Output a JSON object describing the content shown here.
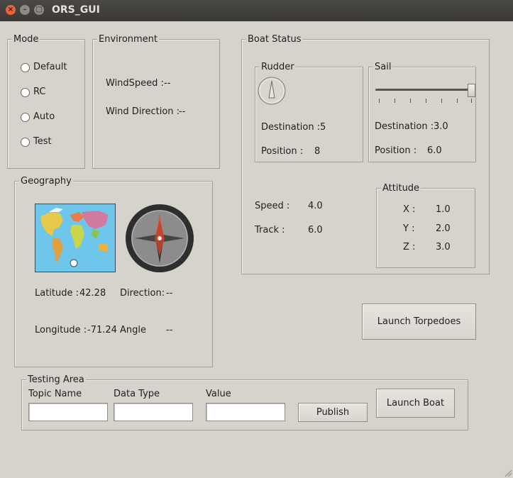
{
  "window": {
    "title": "ORS_GUI"
  },
  "mode": {
    "title": "Mode",
    "options": [
      "Default",
      "RC",
      "Auto",
      "Test"
    ]
  },
  "environment": {
    "title": "Environment",
    "wind_speed_label": "WindSpeed :",
    "wind_speed_value": "--",
    "wind_direction_label": "Wind Direction :",
    "wind_direction_value": "--"
  },
  "geography": {
    "title": "Geography",
    "latitude_label": "Latitude :",
    "latitude_value": "42.28",
    "longitude_label": "Longitude :",
    "longitude_value": "-71.24",
    "direction_label": "Direction:",
    "direction_value": "--",
    "angle_label": "Angle",
    "angle_value": "--"
  },
  "boat_status": {
    "title": "Boat Status",
    "rudder": {
      "title": "Rudder",
      "destination_label": "Destination :",
      "destination_value": "5",
      "position_label": "Position :",
      "position_value": "8"
    },
    "sail": {
      "title": "Sail",
      "destination_label": "Destination :",
      "destination_value": "3.0",
      "position_label": "Position :",
      "position_value": "6.0",
      "slider_level": 1.0
    },
    "speed_label": "Speed :",
    "speed_value": "4.0",
    "track_label": "Track :",
    "track_value": "6.0",
    "attitude": {
      "title": "Attitude",
      "x_label": "X :",
      "x_value": "1.0",
      "y_label": "Y :",
      "y_value": "2.0",
      "z_label": "Z :",
      "z_value": "3.0"
    }
  },
  "launch_torpedoes_label": "Launch Torpedoes",
  "testing": {
    "title": "Testing Area",
    "topic_label": "Topic Name",
    "type_label": "Data Type",
    "value_label": "Value",
    "topic_value": "",
    "type_value": "",
    "value_value": "",
    "publish_label": "Publish",
    "launch_boat_label": "Launch Boat"
  },
  "icons": {
    "map": "world-map-icon",
    "compass": "compass-icon",
    "dial": "rudder-dial-icon"
  }
}
